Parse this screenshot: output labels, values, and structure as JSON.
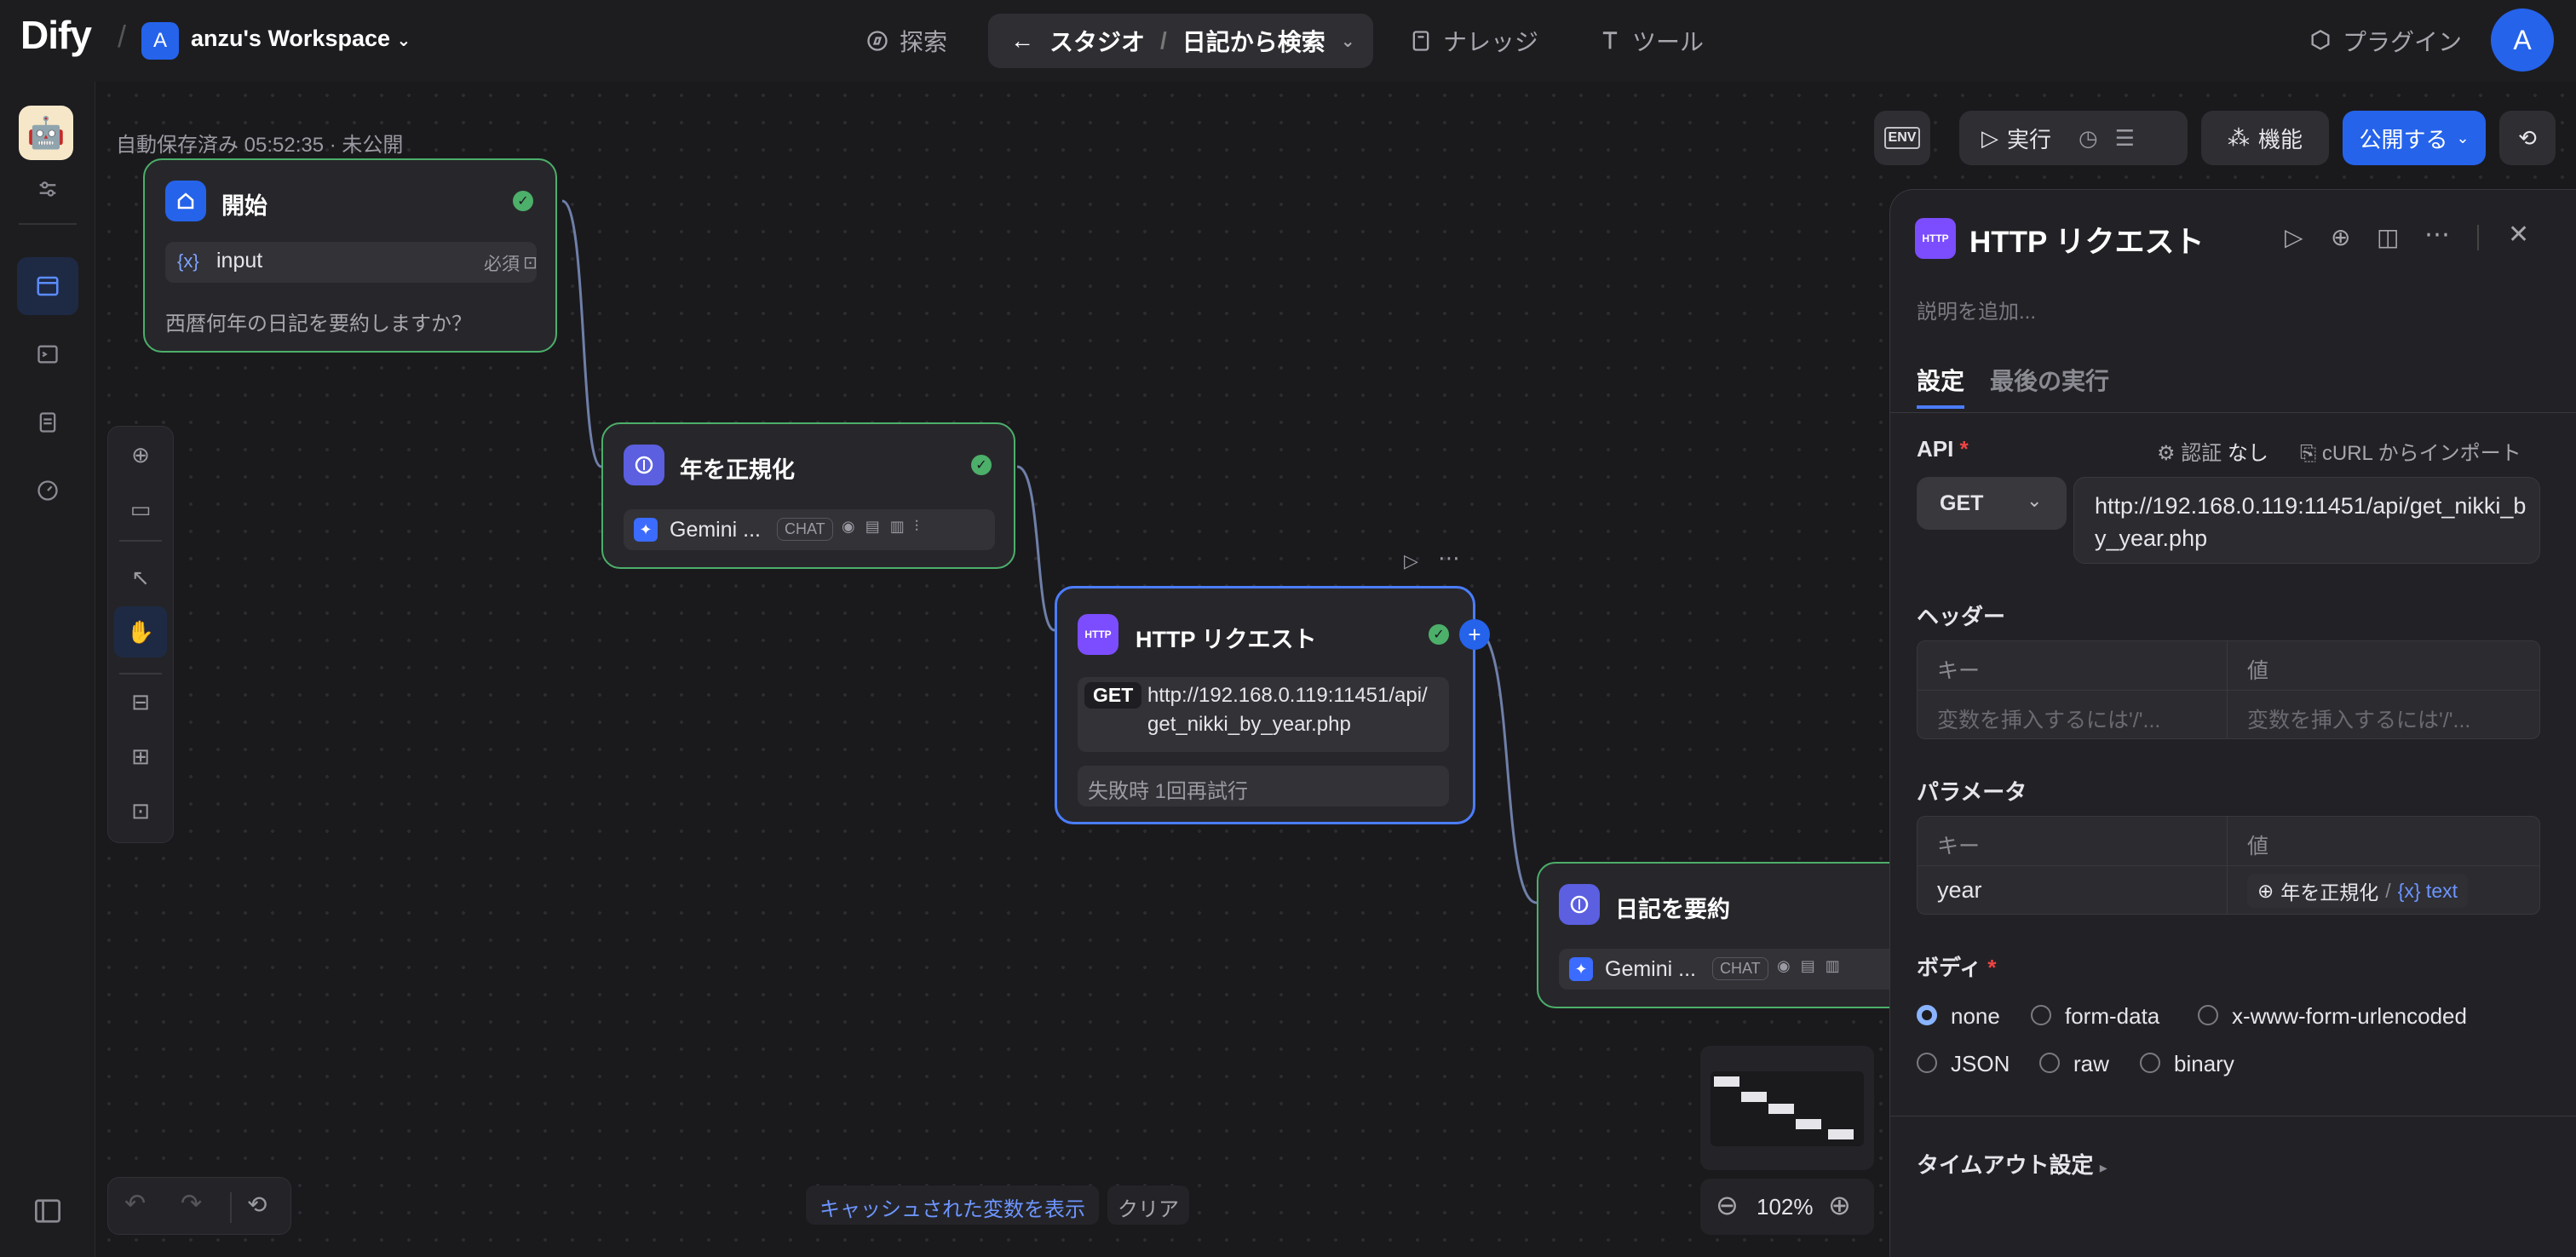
{
  "header": {
    "logo": "Dify",
    "workspace_initial": "A",
    "workspace_name": "anzu's Workspace",
    "nav": {
      "explore": "探索",
      "studio": "スタジオ",
      "app_name": "日記から検索",
      "knowledge": "ナレッジ",
      "tools": "ツール"
    },
    "plugins": "プラグイン",
    "avatar": "A"
  },
  "canvas": {
    "autosave": "自動保存済み 05:52:35 · 未公開",
    "cache_button": "キャッシュされた変数を表示",
    "clear_button": "クリア",
    "zoom": "102%"
  },
  "actions": {
    "env": "ENV",
    "run": "実行",
    "features": "機能",
    "publish": "公開する"
  },
  "nodes": {
    "start": {
      "title": "開始",
      "var_icon": "{x}",
      "var_name": "input",
      "required": "必須",
      "description": "西暦何年の日記を要約しますか？"
    },
    "normalize": {
      "title": "年を正規化",
      "model": "Gemini ...",
      "mode": "CHAT"
    },
    "http": {
      "title": "HTTP リクエスト",
      "badge": "HTTP",
      "method": "GET",
      "url_line1": "http://192.168.0.119:11451/api/",
      "url_line2": "get_nikki_by_year.php",
      "retry": "失敗時 1回再試行"
    },
    "summarize": {
      "title": "日記を要約",
      "model": "Gemini ...",
      "mode": "CHAT"
    }
  },
  "panel": {
    "badge": "HTTP",
    "title": "HTTP リクエスト",
    "description_placeholder": "説明を追加...",
    "tabs": {
      "settings": "設定",
      "last_run": "最後の実行"
    },
    "api_label": "API",
    "auth_label": "認証",
    "auth_value": "なし",
    "curl_import": "cURL からインポート",
    "method": "GET",
    "url": "http://192.168.0.119:11451/api/get_nikki_by_year.php",
    "headers_label": "ヘッダー",
    "key_header": "キー",
    "value_header": "値",
    "header_key_placeholder": "変数を挿入するには'/'...",
    "header_value_placeholder": "変数を挿入するには'/'...",
    "params_label": "パラメータ",
    "param_key": "year",
    "param_value_node": "年を正規化",
    "param_value_sep": "/",
    "param_value_var": "{x} text",
    "body_label": "ボディ",
    "body_options": [
      "none",
      "form-data",
      "x-www-form-urlencoded",
      "JSON",
      "raw",
      "binary"
    ],
    "timeout_label": "タイムアウト設定"
  }
}
